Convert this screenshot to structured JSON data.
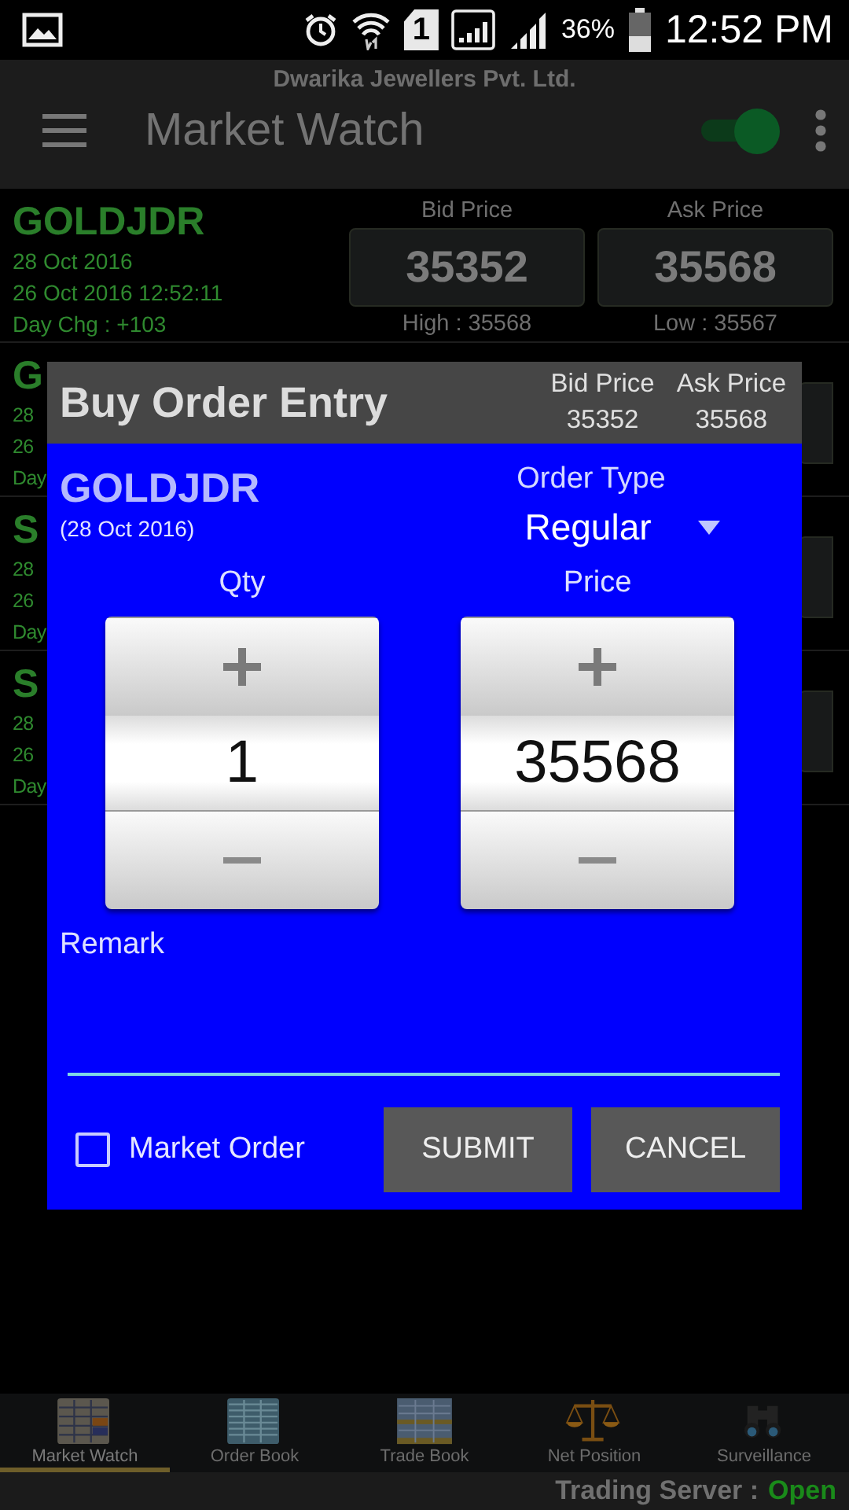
{
  "status_bar": {
    "sim_slot": "1",
    "battery": "36%",
    "time": "12:52 PM"
  },
  "app_bar": {
    "company": "Dwarika Jewellers Pvt. Ltd.",
    "title": "Market Watch",
    "toggle_on": true
  },
  "watch_rows": [
    {
      "kind": "full",
      "name": "GOLDJDR",
      "expiry": "28 Oct 2016",
      "updated": "26 Oct 2016 12:52:11",
      "day_change": "Day Chg :  +103",
      "bid_label": "Bid Price",
      "bid": "35352",
      "ask_label": "Ask Price",
      "ask": "35568",
      "high": "High : 35568",
      "low": "Low : 35567"
    },
    {
      "kind": "covered",
      "name": "G",
      "expiry": "28",
      "updated": "26",
      "day_change": "Day"
    },
    {
      "kind": "covered",
      "name": "S",
      "expiry": "28",
      "updated": "26",
      "day_change": "Day"
    },
    {
      "kind": "covered",
      "name": "S",
      "expiry": "28",
      "updated": "26",
      "day_change": "Day"
    }
  ],
  "dialog": {
    "title": "Buy Order Entry",
    "bid_label": "Bid Price",
    "bid": "35352",
    "ask_label": "Ask Price",
    "ask": "35568",
    "symbol": "GOLDJDR",
    "expiry": "(28 Oct 2016)",
    "order_type_label": "Order Type",
    "order_type": "Regular",
    "qty_label": "Qty",
    "qty": "1",
    "price_label": "Price",
    "price": "35568",
    "remark_label": "Remark",
    "market_order": {
      "label": "Market Order",
      "checked": false
    },
    "buttons": [
      "SUBMIT",
      "CANCEL"
    ]
  },
  "bottom_nav": [
    {
      "label": "Market Watch",
      "selected": true
    },
    {
      "label": "Order Book",
      "selected": false
    },
    {
      "label": "Trade Book",
      "selected": false
    },
    {
      "label": "Net Position",
      "selected": false
    },
    {
      "label": "Surveillance",
      "selected": false
    }
  ],
  "server": {
    "label": "Trading Server :",
    "status": "Open",
    "open": true
  }
}
